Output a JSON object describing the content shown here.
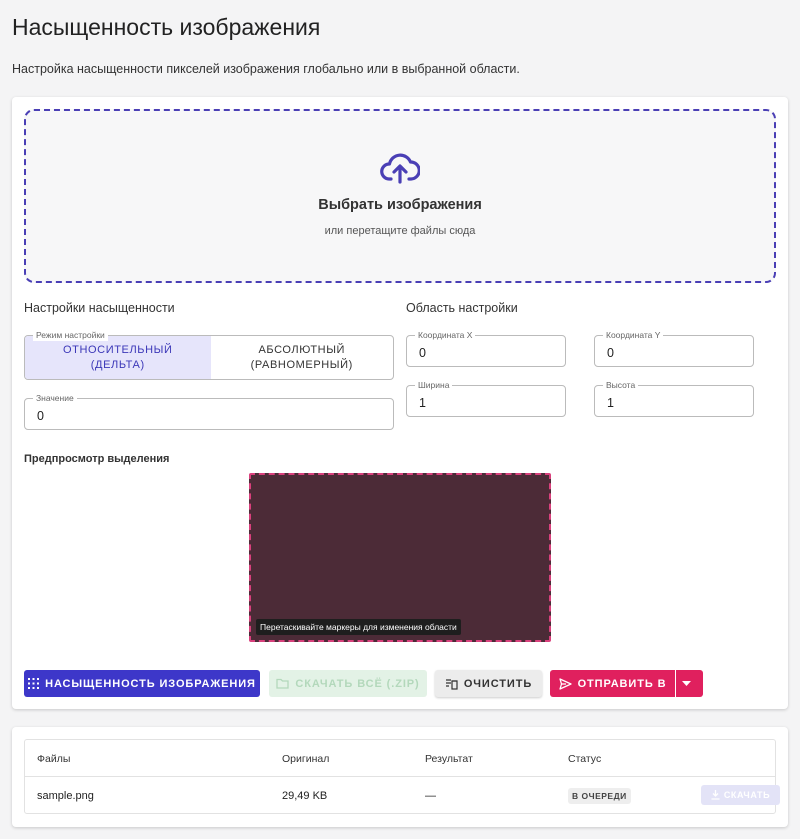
{
  "page": {
    "title": "Насыщенность изображения",
    "subtitle": "Настройка насыщенности пикселей изображения глобально или в выбранной области."
  },
  "dropzone": {
    "icon": "cloud-upload-icon",
    "title": "Выбрать изображения",
    "hint": "или перетащите файлы сюда"
  },
  "saturation": {
    "section_label": "Настройки насыщенности",
    "mode_legend": "Режим настройки",
    "modes": [
      {
        "label": "ОТНОСИТЕЛЬНЫЙ (ДЕЛЬТА)",
        "active": true
      },
      {
        "label": "АБСОЛЮТНЫЙ (РАВНОМЕРНЫЙ)",
        "active": false
      }
    ],
    "value_legend": "Значение",
    "value": "0"
  },
  "region": {
    "section_label": "Область настройки",
    "x_legend": "Координата X",
    "x_value": "0",
    "y_legend": "Координата Y",
    "y_value": "0",
    "width_legend": "Ширина",
    "width_value": "1",
    "height_legend": "Высота",
    "height_value": "1"
  },
  "preview": {
    "label": "Предпросмотр выделения",
    "hint": "Перетаскивайте маркеры для изменения области",
    "fill_color": "#4c2b37",
    "border_color": "#d9407c"
  },
  "actions": {
    "apply_label": "НАСЫЩЕННОСТЬ ИЗОБРАЖЕНИЯ",
    "download_zip_label": "СКАЧАТЬ ВСЁ (.ZIP)",
    "clear_label": "ОЧИСТИТЬ",
    "send_label": "ОТПРАВИТЬ В"
  },
  "files": {
    "columns": [
      "Файлы",
      "Оригинал",
      "Результат",
      "Статус"
    ],
    "rows": [
      {
        "name": "sample.png",
        "original": "29,49 KB",
        "result": "—",
        "status": "В ОЧЕРЕДИ",
        "download_label": "СКАЧАТЬ"
      }
    ]
  },
  "colors": {
    "primary": "#3d37c9",
    "accent": "#e0205e",
    "dropzone_border": "#4a3fb5"
  }
}
